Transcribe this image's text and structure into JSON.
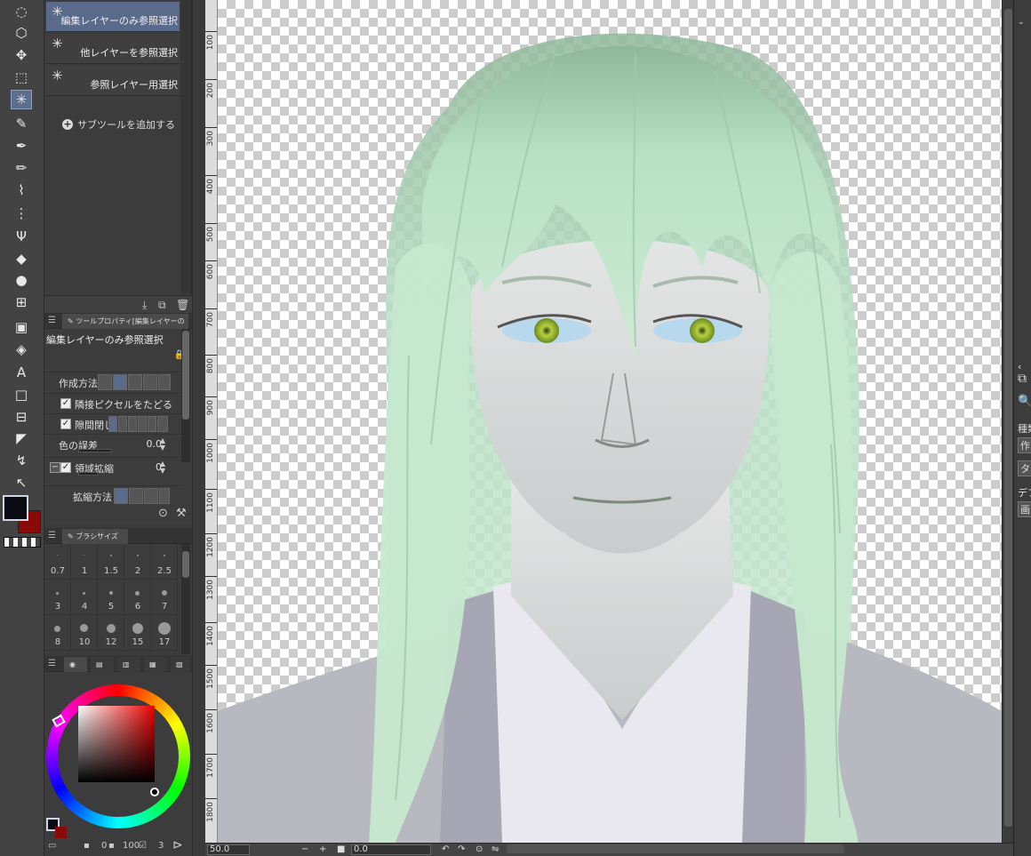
{
  "subtool": {
    "items": [
      {
        "label": "編集レイヤーのみ参照選択",
        "selected": true
      },
      {
        "label": "他レイヤーを参照選択",
        "selected": false
      },
      {
        "label": "参照レイヤー用選択",
        "selected": false
      }
    ],
    "add_label": "サブツールを追加する"
  },
  "tool_property": {
    "tab_label": "ツールプロパティ[編集レイヤーの",
    "tool_name": "編集レイヤーのみ参照選択",
    "creation_method_label": "作成方法",
    "adjacent_pixels_label": "隣接ピクセルをたどる",
    "close_gap_label": "隙間閉じ",
    "color_tolerance_label": "色の誤差",
    "color_tolerance_value": "0.0",
    "area_scaling_label": "領域拡縮",
    "area_scaling_value": "0",
    "scaling_method_label": "拡縮方法"
  },
  "brush_size": {
    "tab_label": "ブラシサイズ",
    "sizes": [
      "0.7",
      "1",
      "1.5",
      "2",
      "2.5",
      "3",
      "4",
      "5",
      "6",
      "7",
      "8",
      "10",
      "12",
      "15",
      "17"
    ]
  },
  "color_panel": {
    "main_color": "#0a0a12",
    "sub_color": "#8a0a0a",
    "opacity_value": "0",
    "hue_value": "100",
    "val3": "3"
  },
  "ruler": {
    "ticks": [
      "100",
      "200",
      "300",
      "400",
      "500",
      "600",
      "700",
      "800",
      "900",
      "1000",
      "1100",
      "1200",
      "1300",
      "1400",
      "1500",
      "1600",
      "1700",
      "1800"
    ]
  },
  "status": {
    "zoom": "50.0",
    "rotation": "0.0"
  },
  "right_panel": {
    "kind_label": "種類",
    "create_label": "作",
    "tab_label": "タ",
    "default_label": "デフ",
    "screen_label": "画"
  }
}
